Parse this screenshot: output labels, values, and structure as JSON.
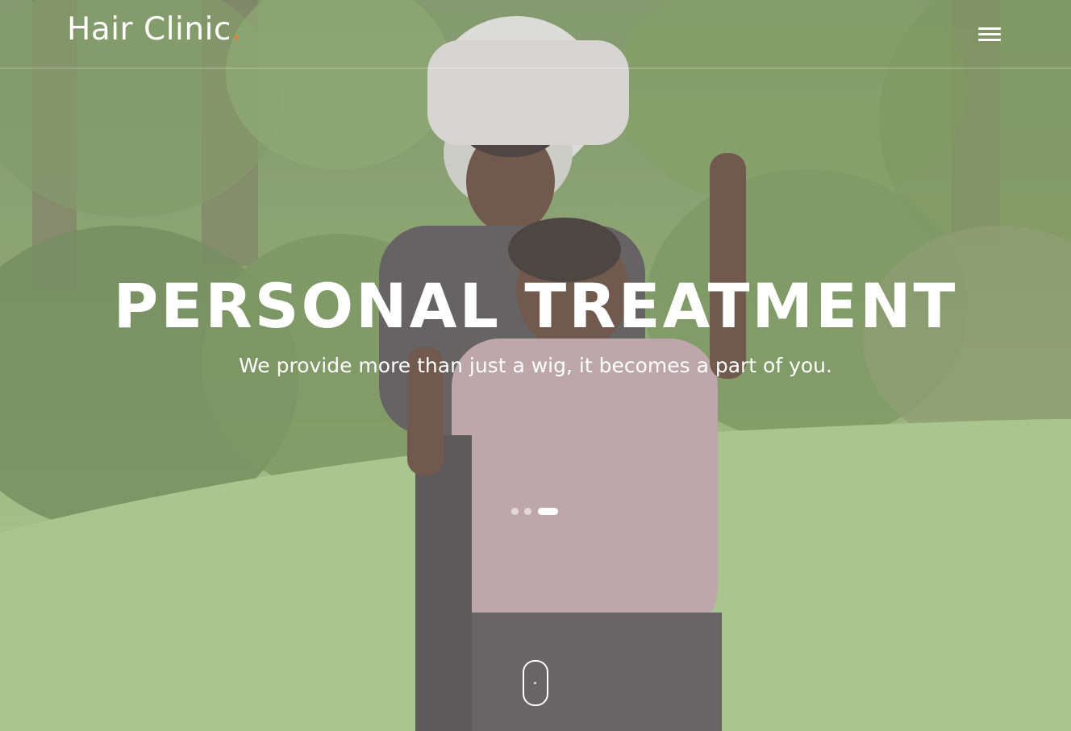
{
  "header": {
    "logo_text": "Hair Clinic",
    "logo_dot": ".",
    "menu_icon": "hamburger-menu-icon"
  },
  "hero": {
    "title": "PERSONAL TREATMENT",
    "subtitle": "We provide more than just a wig, it becomes a part of you.",
    "background_image": "family-outdoors-photo"
  },
  "slider": {
    "slide_count": 3,
    "active_slide": 3
  },
  "scroll_indicator": {
    "icon": "mouse-scroll-icon"
  },
  "colors": {
    "accent": "#f07b2e",
    "text": "#ffffff",
    "grass": "#9cbf7c",
    "foliage": "#5f7a45"
  }
}
